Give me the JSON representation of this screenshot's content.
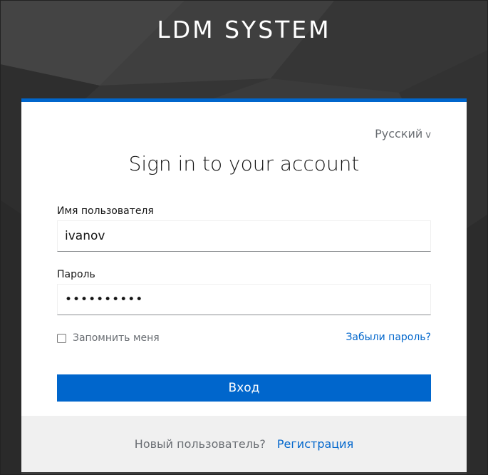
{
  "header": {
    "brand": "LDM SYSTEM"
  },
  "card": {
    "language": {
      "selected": "Русский",
      "chevron": "v"
    },
    "title": "Sign in to your account",
    "username": {
      "label": "Имя пользователя",
      "value": "ivanov"
    },
    "password": {
      "label": "Пароль",
      "value": "••••••••••"
    },
    "remember_me": {
      "label": "Запомнить меня",
      "checked": false
    },
    "forgot_password": "Забыли пароль?",
    "submit_label": "Вход"
  },
  "footer": {
    "question": "Новый пользователь?",
    "register_link": "Регистрация"
  },
  "colors": {
    "accent": "#0066cc",
    "background": "#3a3a3a",
    "card": "#ffffff",
    "footer": "#f0f0f0"
  }
}
